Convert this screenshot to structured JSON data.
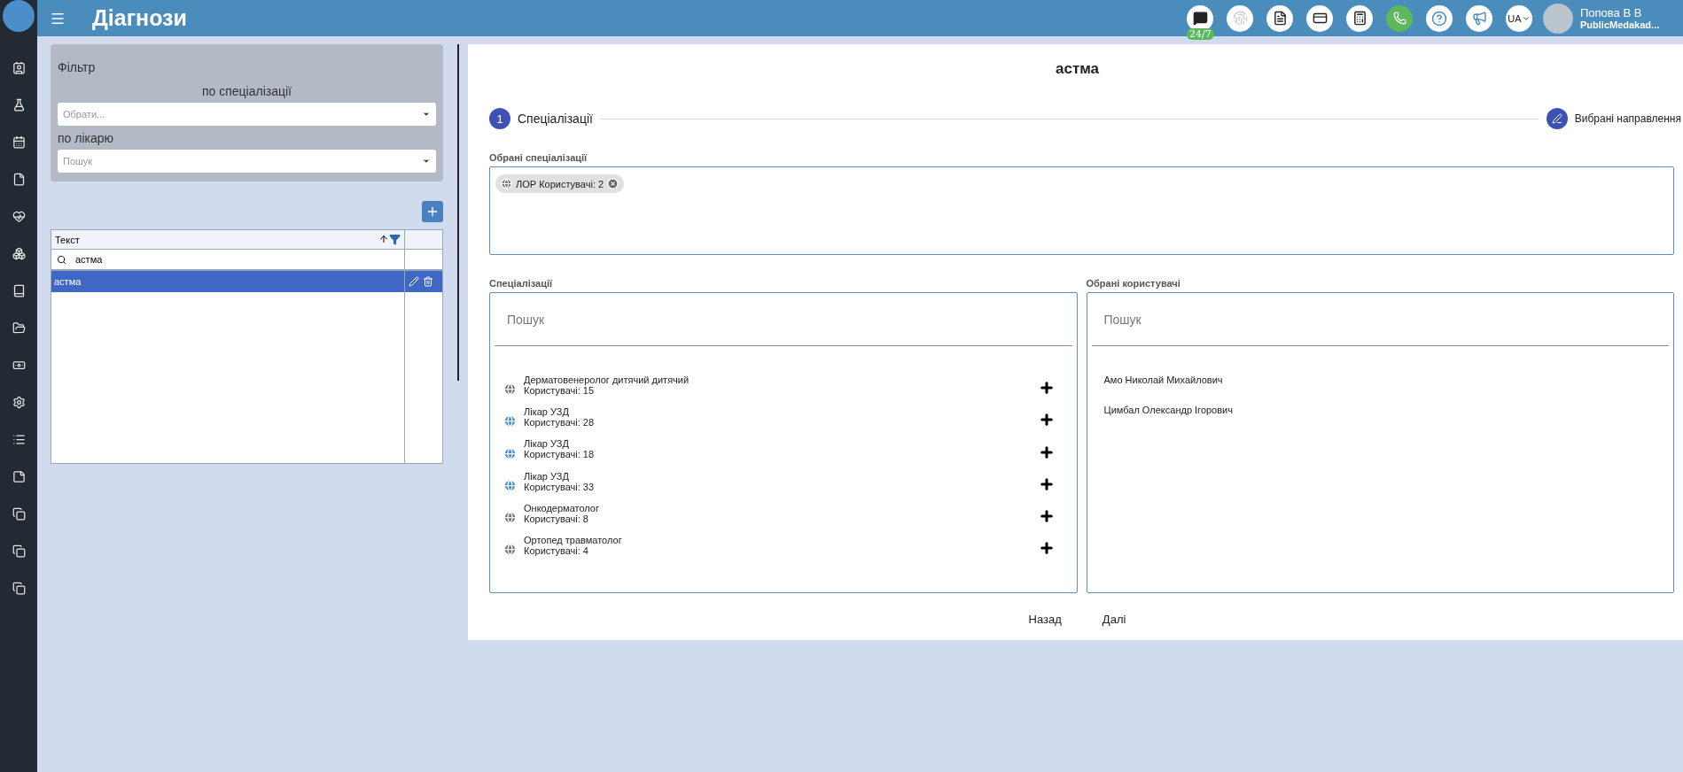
{
  "header": {
    "title": "Діагнози",
    "chat_badge": "24/7",
    "language": "UA",
    "user_name": "Попова В В",
    "user_org": "PublicMedakad..."
  },
  "filter": {
    "title": "Фільтр",
    "specialization_label": "по спеціалізації",
    "specialization_placeholder": "Обрати...",
    "doctor_label": "по лікарю",
    "doctor_placeholder": "Пошук"
  },
  "table": {
    "column": "Текст",
    "search_value": "астма",
    "rows": [
      {
        "text": "астма",
        "selected": true
      }
    ]
  },
  "editor": {
    "title": "астма",
    "steps": [
      {
        "number": "1",
        "label": "Спеціалізації",
        "kind": "number"
      },
      {
        "label": "Вибрані направлення",
        "kind": "edit"
      }
    ],
    "chosen_label": "Обрані спеціалізації",
    "chips": [
      {
        "text": "ЛОР Користувачі: 2"
      }
    ],
    "specs_label": "Спеціалізації",
    "specs_placeholder": "Пошук",
    "specs": [
      {
        "name": "Дерматовенеролог дитячий дитячий",
        "users": "Користувачі: 15",
        "color": "#757575"
      },
      {
        "name": "Лікар УЗД",
        "users": "Користувачі: 28",
        "color": "#4a8fc9"
      },
      {
        "name": "Лікар УЗД",
        "users": "Користувачі: 18",
        "color": "#4a8fc9"
      },
      {
        "name": "Лікар УЗД",
        "users": "Користувачі: 33",
        "color": "#4a8fc9"
      },
      {
        "name": "Онкодерматолог",
        "users": "Користувачі: 8",
        "color": "#757575"
      },
      {
        "name": "Ортопед травматолог",
        "users": "Користувачі: 4",
        "color": "#757575"
      }
    ],
    "users_label": "Обрані користувачі",
    "users_placeholder": "Пошук",
    "users": [
      "Амо Николай Михайлович",
      "Цимбал Олександр Ігорович"
    ],
    "back": "Назад",
    "next": "Далі"
  }
}
